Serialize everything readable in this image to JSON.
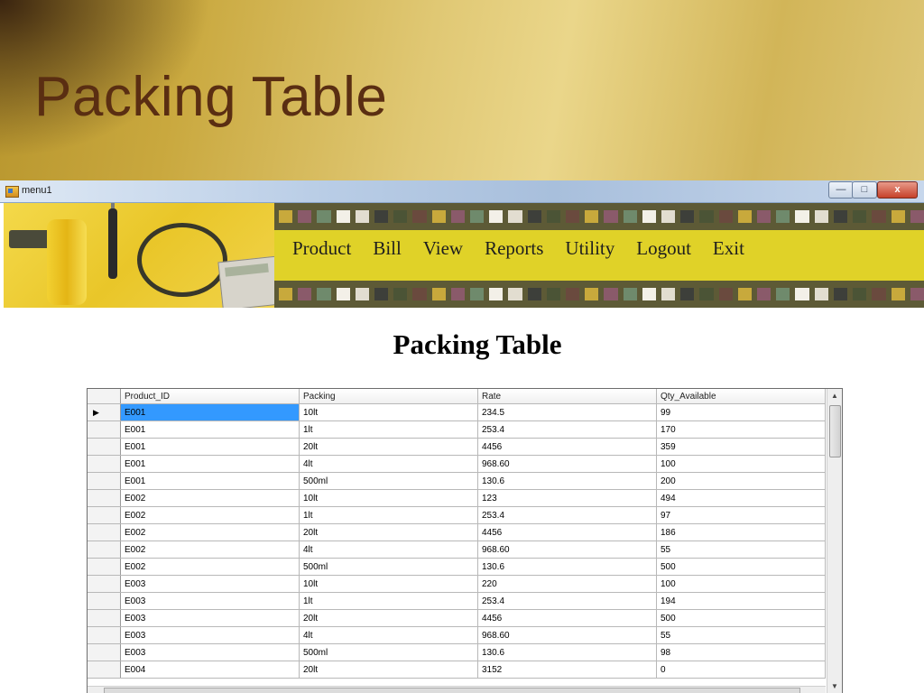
{
  "slide": {
    "title": "Packing Table"
  },
  "window": {
    "title": "menu1",
    "controls": {
      "minimize": "—",
      "maximize": "□",
      "close": "x"
    }
  },
  "menu": {
    "items": [
      "Product",
      "Bill",
      "View",
      "Reports",
      "Utility",
      "Logout",
      "Exit"
    ]
  },
  "page": {
    "heading": "Packing Table"
  },
  "film_colors": [
    "#c8a93c",
    "#8a5a6a",
    "#6f8a6c",
    "#f3f0e8",
    "#e2ddd0",
    "#3d3f3a",
    "#4b5436",
    "#6a4a3e"
  ],
  "grid": {
    "columns": [
      "Product_ID",
      "Packing",
      "Rate",
      "Qty_Available"
    ],
    "selected_row": 0,
    "rows": [
      [
        "E001",
        "10lt",
        "234.5",
        "99"
      ],
      [
        "E001",
        "1lt",
        "253.4",
        "170"
      ],
      [
        "E001",
        "20lt",
        "4456",
        "359"
      ],
      [
        "E001",
        "4lt",
        "968.60",
        "100"
      ],
      [
        "E001",
        "500ml",
        "130.6",
        "200"
      ],
      [
        "E002",
        "10lt",
        "123",
        "494"
      ],
      [
        "E002",
        "1lt",
        "253.4",
        "97"
      ],
      [
        "E002",
        "20lt",
        "4456",
        "186"
      ],
      [
        "E002",
        "4lt",
        "968.60",
        "55"
      ],
      [
        "E002",
        "500ml",
        "130.6",
        "500"
      ],
      [
        "E003",
        "10lt",
        "220",
        "100"
      ],
      [
        "E003",
        "1lt",
        "253.4",
        "194"
      ],
      [
        "E003",
        "20lt",
        "4456",
        "500"
      ],
      [
        "E003",
        "4lt",
        "968.60",
        "55"
      ],
      [
        "E003",
        "500ml",
        "130.6",
        "98"
      ],
      [
        "E004",
        "20lt",
        "3152",
        "0"
      ]
    ]
  }
}
